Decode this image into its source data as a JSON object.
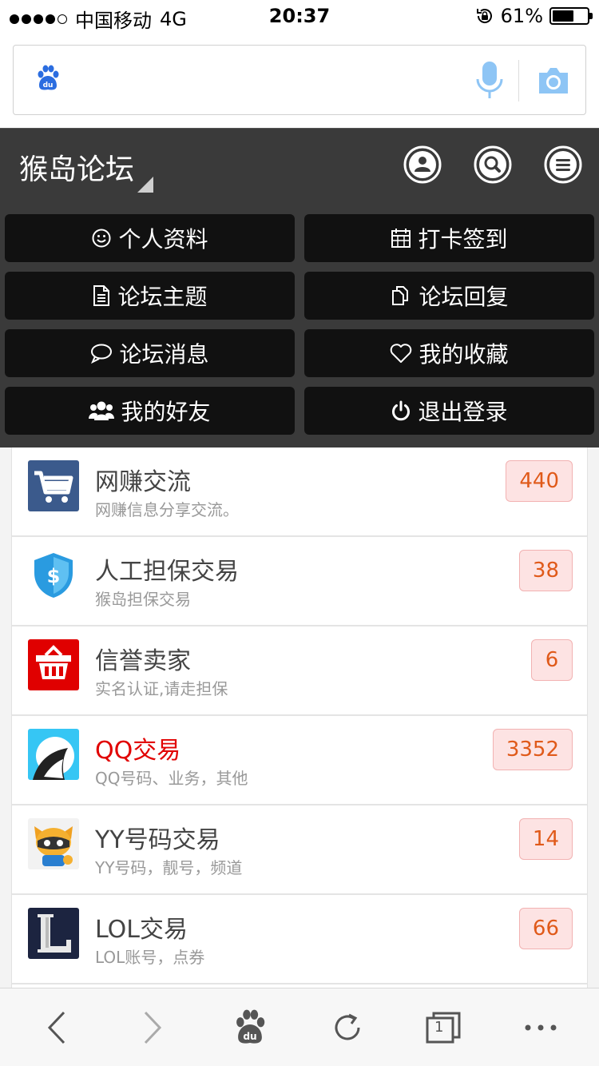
{
  "status_bar": {
    "carrier": "中国移动",
    "network": "4G",
    "time": "20:37",
    "battery": "61%",
    "battery_level": 0.61
  },
  "search": {
    "value": "",
    "placeholder": ""
  },
  "header": {
    "title": "猴岛论坛"
  },
  "menu": {
    "items": [
      {
        "label": "个人资料"
      },
      {
        "label": "打卡签到"
      },
      {
        "label": "论坛主题"
      },
      {
        "label": "论坛回复"
      },
      {
        "label": "论坛消息"
      },
      {
        "label": "我的收藏"
      },
      {
        "label": "我的好友"
      },
      {
        "label": "退出登录"
      }
    ]
  },
  "forums": [
    {
      "name": "网赚交流",
      "desc": "网赚信息分享交流。",
      "count": "440"
    },
    {
      "name": "人工担保交易",
      "desc": "猴岛担保交易",
      "count": "38"
    },
    {
      "name": "信誉卖家",
      "desc": "实名认证,请走担保",
      "count": "6"
    },
    {
      "name": "QQ交易",
      "desc": "QQ号码、业务，其他",
      "count": "3352",
      "highlight": true
    },
    {
      "name": "YY号码交易",
      "desc": "YY号码，靓号，频道",
      "count": "14"
    },
    {
      "name": "LOL交易",
      "desc": "LOL账号，点券",
      "count": "66"
    }
  ],
  "bottom_bar": {
    "tab_count": "1"
  },
  "colors": {
    "header_bg": "#3a3a3a",
    "menu_button_bg": "#111111",
    "badge_bg": "#fde3e3",
    "badge_text": "#e05a1a",
    "highlight_text": "#e10000",
    "accent_blue": "#2b7ef0"
  }
}
